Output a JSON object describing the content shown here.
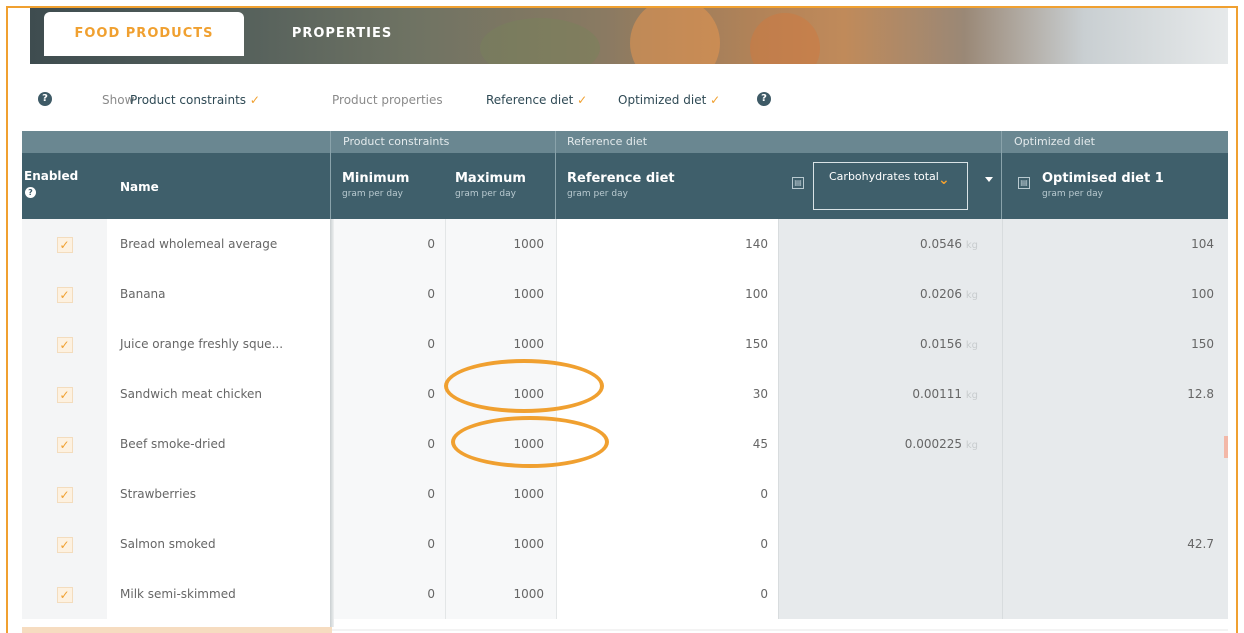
{
  "tabs": [
    {
      "label": "FOOD PRODUCTS",
      "active": true
    },
    {
      "label": "PROPERTIES",
      "active": false
    }
  ],
  "showbar": {
    "show_label": "Show",
    "toggles": [
      {
        "label": "Product constraints",
        "checked": true
      },
      {
        "label": "Product properties",
        "checked": false
      },
      {
        "label": "Reference diet",
        "checked": true
      },
      {
        "label": "Optimized diet",
        "checked": true
      }
    ],
    "checkmark": "✓"
  },
  "groups": {
    "product_constraints": "Product constraints",
    "reference_diet": "Reference diet",
    "optimized_diet": "Optimized diet"
  },
  "columns": {
    "enabled": "Enabled",
    "name": "Name",
    "minimum": {
      "title": "Minimum",
      "unit": "gram per day"
    },
    "maximum": {
      "title": "Maximum",
      "unit": "gram per day"
    },
    "reference": {
      "title": "Reference diet",
      "unit": "gram per day"
    },
    "property_select": "Carbohydrates total",
    "optimised": {
      "title": "Optimised diet 1",
      "unit": "gram per day"
    }
  },
  "icons": {
    "help": "?",
    "calc": "▤",
    "chevron": "⌄"
  },
  "unit_kg": "kg",
  "rows": [
    {
      "enabled": "✓",
      "name": "Bread wholemeal average",
      "min": "0",
      "max": "1000",
      "ref": "140",
      "carb": "0.0546",
      "opt": "104"
    },
    {
      "enabled": "✓",
      "name": "Banana",
      "min": "0",
      "max": "1000",
      "ref": "100",
      "carb": "0.0206",
      "opt": "100"
    },
    {
      "enabled": "✓",
      "name": "Juice orange freshly sque...",
      "min": "0",
      "max": "1000",
      "ref": "150",
      "carb": "0.0156",
      "opt": "150"
    },
    {
      "enabled": "✓",
      "name": "Sandwich meat chicken",
      "min": "0",
      "max": "1000",
      "ref": "30",
      "carb": "0.00111",
      "opt": "12.8"
    },
    {
      "enabled": "✓",
      "name": "Beef smoke-dried",
      "min": "0",
      "max": "1000",
      "ref": "45",
      "carb": "0.000225",
      "opt": ""
    },
    {
      "enabled": "✓",
      "name": "Strawberries",
      "min": "0",
      "max": "1000",
      "ref": "0",
      "carb": "",
      "opt": ""
    },
    {
      "enabled": "✓",
      "name": "Salmon smoked",
      "min": "0",
      "max": "1000",
      "ref": "0",
      "carb": "",
      "opt": "42.7"
    },
    {
      "enabled": "✓",
      "name": "Milk semi-skimmed",
      "min": "0",
      "max": "1000",
      "ref": "0",
      "carb": "",
      "opt": ""
    }
  ],
  "accent_color": "#f0a030",
  "header_color": "#3f5f6b"
}
